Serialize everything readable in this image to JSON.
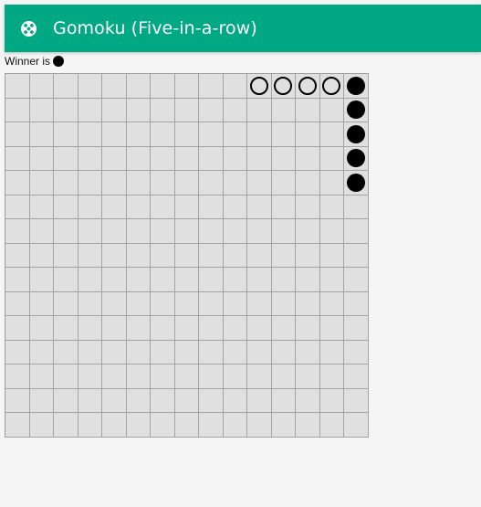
{
  "header": {
    "title": "Gomoku (Five-in-a-row)",
    "icon": "dice-icon",
    "color": "#00a884"
  },
  "status": {
    "label": "Winner is",
    "winner": "black"
  },
  "board": {
    "size": 15,
    "stones": [
      {
        "row": 0,
        "col": 10,
        "color": "white"
      },
      {
        "row": 0,
        "col": 11,
        "color": "white"
      },
      {
        "row": 0,
        "col": 12,
        "color": "white"
      },
      {
        "row": 0,
        "col": 13,
        "color": "white"
      },
      {
        "row": 0,
        "col": 14,
        "color": "black"
      },
      {
        "row": 1,
        "col": 14,
        "color": "black"
      },
      {
        "row": 2,
        "col": 14,
        "color": "black"
      },
      {
        "row": 3,
        "col": 14,
        "color": "black"
      },
      {
        "row": 4,
        "col": 14,
        "color": "black"
      }
    ]
  }
}
